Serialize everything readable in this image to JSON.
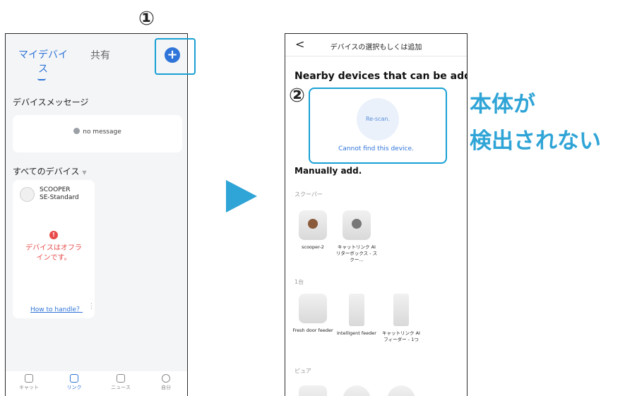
{
  "callouts": {
    "step1": "①",
    "step2": "②",
    "note_line1": "本体が",
    "note_line2": "検出されない"
  },
  "left_screen": {
    "tab_my_devices": "マイデバイス",
    "tab_shared": "共有",
    "add_button": "+",
    "device_messages_title": "デバイスメッセージ",
    "no_message": "no message",
    "all_devices_title": "すべてのデバイス",
    "device_name_line1": "SCOOPER",
    "device_name_line2": "SE-Standard",
    "offline_badge": "!",
    "offline_text": "デバイスはオフラインです。",
    "how_to_handle": "How to handle？",
    "bottom_nav": [
      "キャット",
      "リンク",
      "ニュース",
      "自分"
    ]
  },
  "right_screen": {
    "back": "<",
    "title": "デバイスの選択もしくは追加",
    "nearby_title": "Nearby devices that can be added.",
    "rescan": "Re-scan.",
    "cannot_find": "Cannot find this device.",
    "manual_title": "Manually add.",
    "categories": [
      {
        "label": "スクーパー",
        "products": [
          "scooper-2",
          "キャットリンク AI リターボックス - スクー..."
        ]
      },
      {
        "label": "1台",
        "products": [
          "Fresh door feeder",
          "Intelligent feeder",
          "キャットリンク AI フィーダー - 1つ"
        ]
      },
      {
        "label": "ピュア",
        "products": []
      }
    ]
  }
}
